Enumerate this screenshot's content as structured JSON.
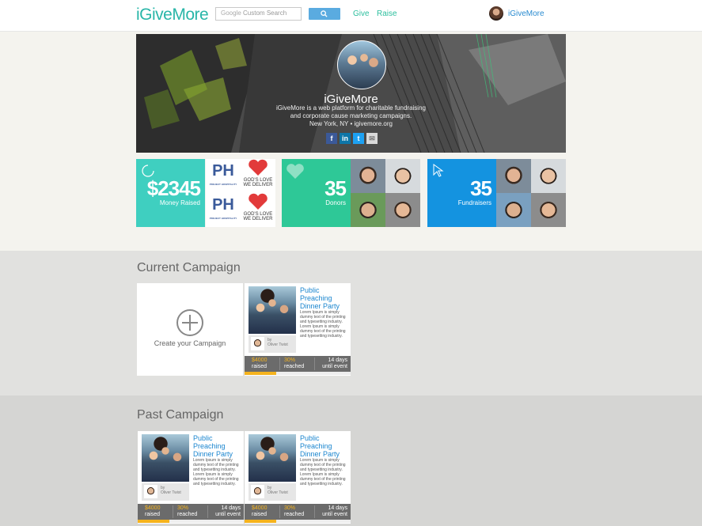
{
  "header": {
    "logo_prefix": "i",
    "logo_main": "GiveMore",
    "search_placeholder_brand": "Google",
    "search_placeholder": "Custom Search",
    "nav": [
      {
        "label": "Give"
      },
      {
        "label": "Raise"
      }
    ],
    "user_name": "iGiveMore"
  },
  "hero": {
    "title": "iGiveMore",
    "description_line1": "iGiveMore is a web platform for charitable fundraising",
    "description_line2": "and corporate cause marketing campaigns.",
    "description_line3": "New York, NY • igivemore.org",
    "social": {
      "facebook": "f",
      "linkedin": "in",
      "twitter": "t",
      "email": "✉"
    }
  },
  "stats": {
    "money": {
      "value": "$2345",
      "label": "Money Raised"
    },
    "donors": {
      "value": "35",
      "label": "Donors"
    },
    "fundraisers": {
      "value": "35",
      "label": "Fundraisers"
    }
  },
  "partner_logos": {
    "ph_text": "PH",
    "ph_sub": "PROJECT HOSPITALITY",
    "gods_love_line1": "GOD'S LOVE",
    "gods_love_line2": "WE DELIVER"
  },
  "current": {
    "section_title": "Current Campaign",
    "create_label": "Create your Campaign"
  },
  "past": {
    "section_title": "Past Campaign"
  },
  "campaign": {
    "title": "Public Preaching Dinner Party",
    "description": "Lorem Ipsum is simply dummy text of the printing and typesetting industry. Lorem Ipsum is simply dummy text of the printing and typesetting industry.",
    "by_prefix": "by",
    "author": "Oliver Twist",
    "raised_value": "$4000",
    "raised_label": "raised",
    "reached_value": "30%",
    "reached_label": "reached",
    "days_value": "14 days",
    "days_label": "until event",
    "progress_fraction": 0.3
  },
  "colors": {
    "money": "#3fcfc0",
    "donors": "#2ec897",
    "fundraisers": "#1493e0",
    "accent": "#f5b31d",
    "link": "#1b86cf"
  }
}
